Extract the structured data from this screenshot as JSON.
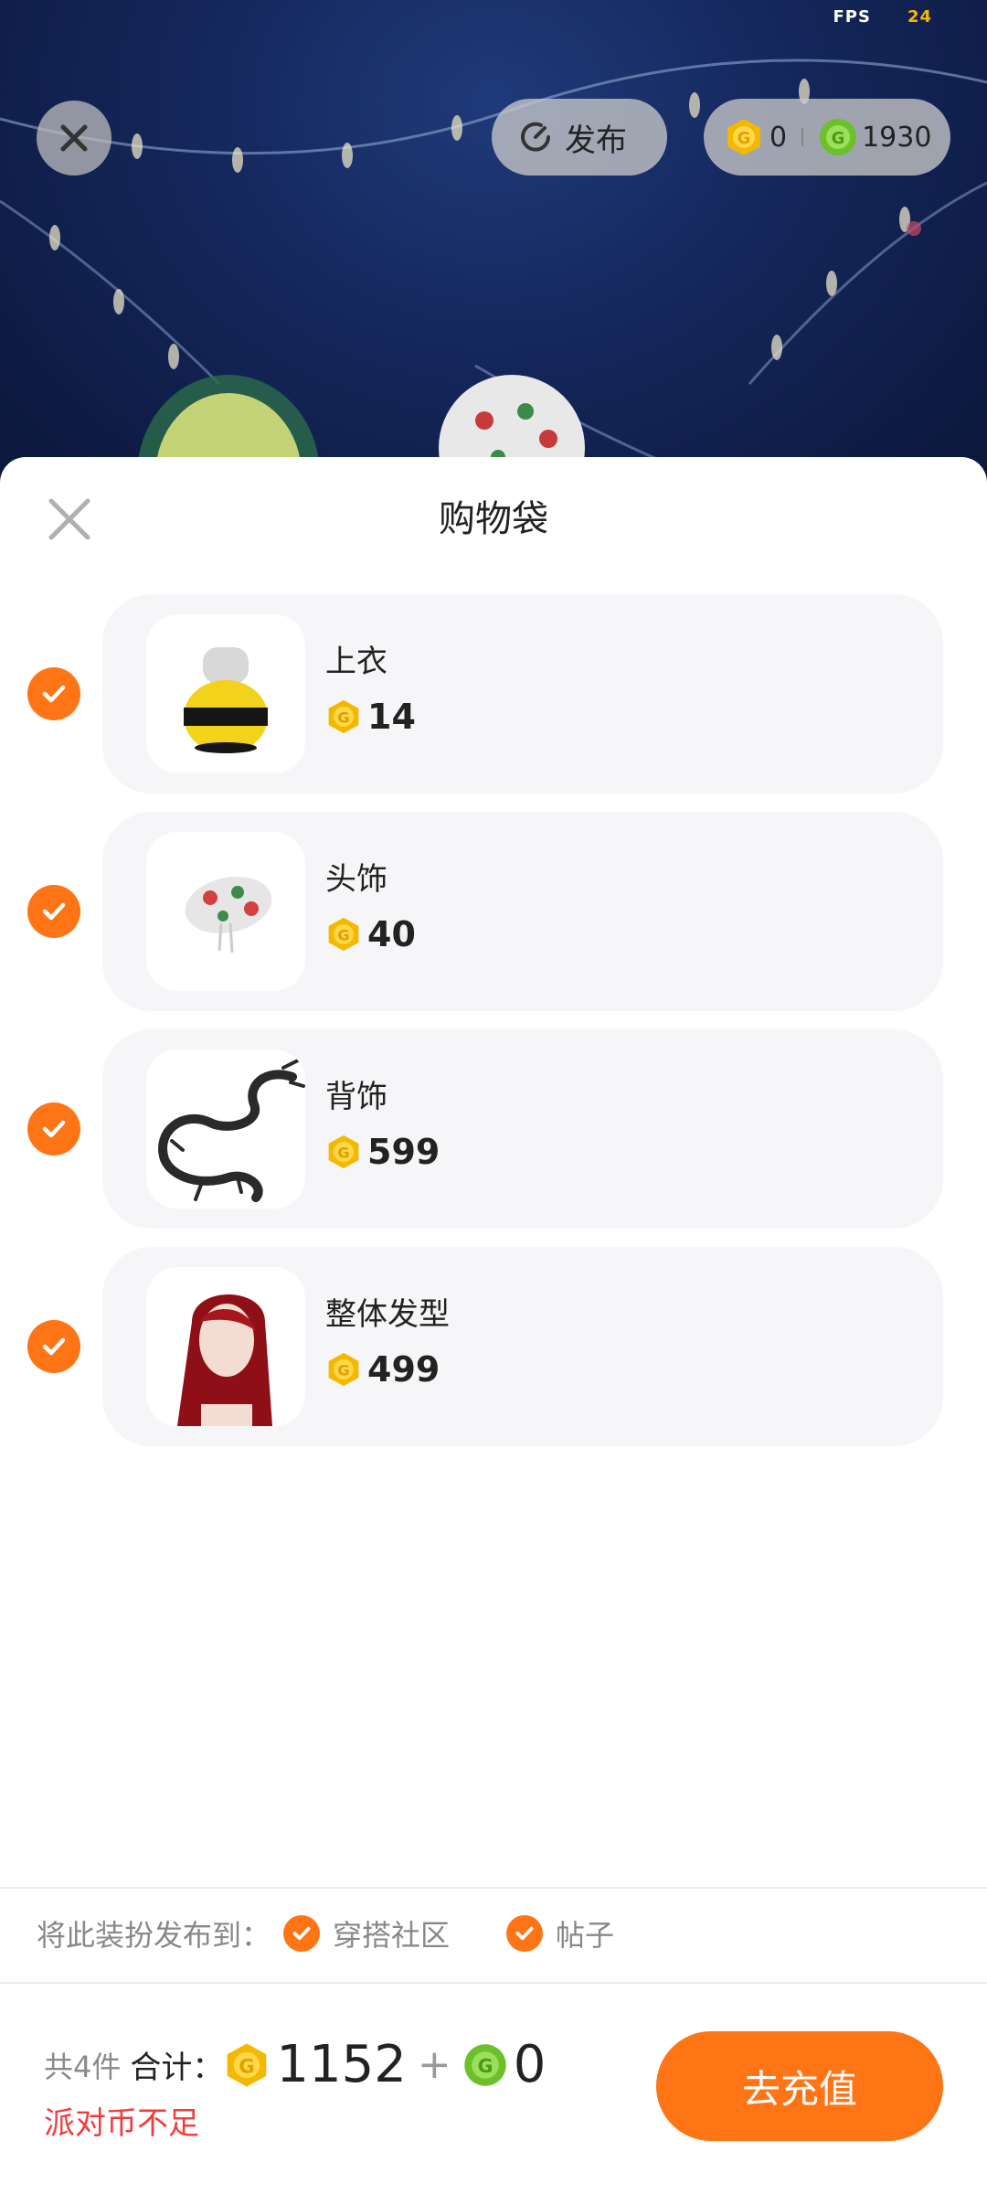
{
  "hud": {
    "fps_label": "FPS",
    "fps_value": "24",
    "publish_label": "发布",
    "gold_balance": "0",
    "green_balance": "1930"
  },
  "sheet": {
    "title": "购物袋",
    "items": [
      {
        "name": "上衣",
        "price": "14",
        "checked": true,
        "thumbnail_icon": "bee-top-icon"
      },
      {
        "name": "头饰",
        "price": "40",
        "checked": true,
        "thumbnail_icon": "floral-hat-icon"
      },
      {
        "name": "背饰",
        "price": "599",
        "checked": true,
        "thumbnail_icon": "dragon-back-icon"
      },
      {
        "name": "整体发型",
        "price": "499",
        "checked": true,
        "thumbnail_icon": "red-hair-icon"
      }
    ]
  },
  "publish": {
    "label": "将此装扮发布到：",
    "options": [
      {
        "label": "穿搭社区",
        "checked": true
      },
      {
        "label": "帖子",
        "checked": true
      }
    ]
  },
  "footer": {
    "count_text": "共4件",
    "total_label": "合计：",
    "gold_total": "1152",
    "plus": "+",
    "green_total": "0",
    "warning": "派对币不足",
    "recharge_label": "去充值"
  },
  "colors": {
    "accent": "#ff7414",
    "warning": "#f23c3c",
    "gold_coin": "#f5b800",
    "green_coin": "#6cc02a"
  }
}
